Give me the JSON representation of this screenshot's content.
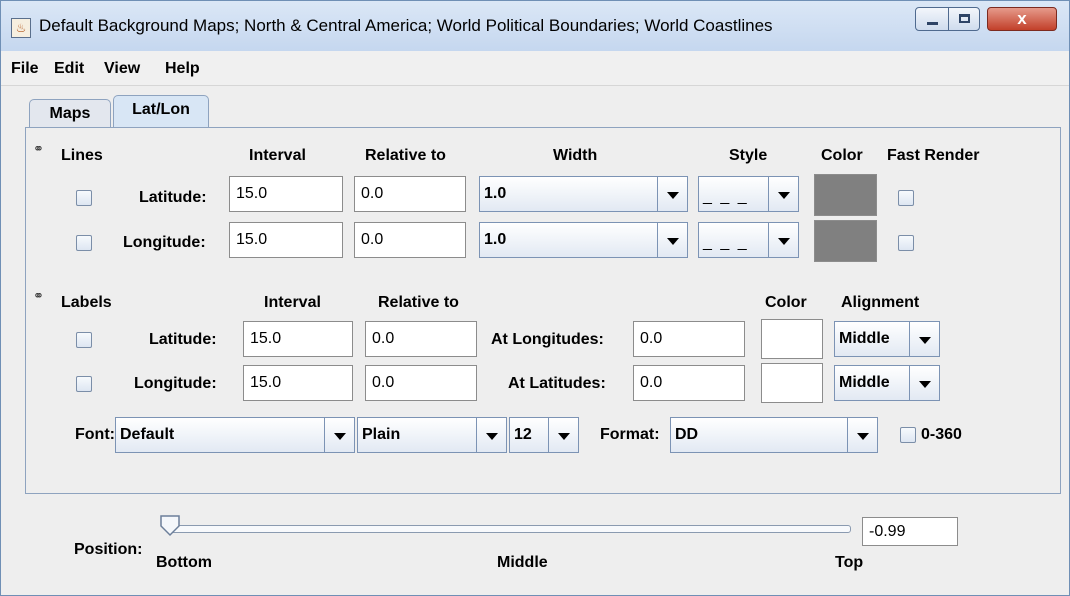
{
  "window": {
    "title": "Default Background Maps; North & Central America; World Political Boundaries; World Coastlines",
    "buttons": {
      "minimize_icon": "minimize-icon",
      "maximize_icon": "maximize-icon",
      "close_glyph": "x"
    }
  },
  "menubar": {
    "items": [
      "File",
      "Edit",
      "View",
      "Help"
    ]
  },
  "tabs": [
    {
      "label": "Maps",
      "active": false
    },
    {
      "label": "Lat/Lon",
      "active": true
    }
  ],
  "lines": {
    "section_label": "Lines",
    "headers": {
      "interval": "Interval",
      "relative_to": "Relative to",
      "width": "Width",
      "style": "Style",
      "color": "Color",
      "fast_render": "Fast Render"
    },
    "rows": [
      {
        "label": "Latitude:",
        "interval": "15.0",
        "relative_to": "0.0",
        "width": "1.0",
        "style": "_ _ _",
        "color": "#808080",
        "enabled": false,
        "fast_render": false
      },
      {
        "label": "Longitude:",
        "interval": "15.0",
        "relative_to": "0.0",
        "width": "1.0",
        "style": "_ _ _",
        "color": "#808080",
        "enabled": false,
        "fast_render": false
      }
    ]
  },
  "labels": {
    "section_label": "Labels",
    "headers": {
      "interval": "Interval",
      "relative_to": "Relative to",
      "color": "Color",
      "alignment": "Alignment"
    },
    "rows": [
      {
        "label": "Latitude:",
        "interval": "15.0",
        "relative_to": "0.0",
        "at_label": "At Longitudes:",
        "at_value": "0.0",
        "color": "#ffffff",
        "alignment": "Middle",
        "enabled": false
      },
      {
        "label": "Longitude:",
        "interval": "15.0",
        "relative_to": "0.0",
        "at_label": "At Latitudes:",
        "at_value": "0.0",
        "color": "#ffffff",
        "alignment": "Middle",
        "enabled": false
      }
    ],
    "font_label": "Font:",
    "font_value": "Default",
    "font_style": "Plain",
    "font_size": "12",
    "format_label": "Format:",
    "format_value": "DD",
    "range_360_label": "0-360",
    "range_360_checked": false
  },
  "position": {
    "label": "Position:",
    "bottom_label": "Bottom",
    "middle_label": "Middle",
    "top_label": "Top",
    "value": "-0.99",
    "slider_fraction": 0.0
  },
  "colors": {
    "accent": "#6f8fb5",
    "swatch_gray": "#808080"
  }
}
